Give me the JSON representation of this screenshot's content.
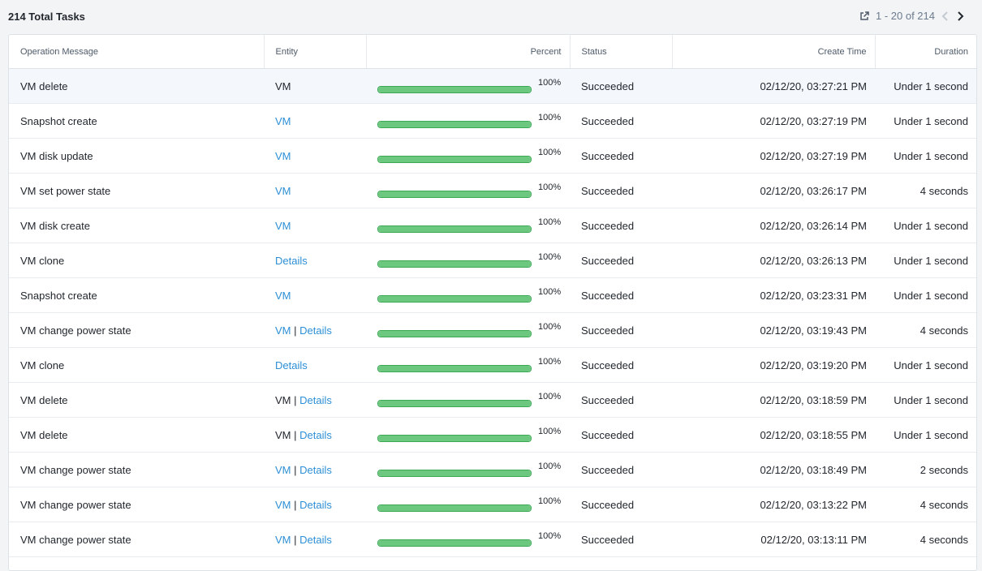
{
  "header": {
    "total_tasks": "214 Total Tasks",
    "pagination": "1 - 20 of 214",
    "icons": [
      "external-link-icon",
      "chevron-left-icon",
      "chevron-right-icon"
    ]
  },
  "columns": {
    "operation": "Operation Message",
    "entity": "Entity",
    "percent": "Percent",
    "status": "Status",
    "create_time": "Create Time",
    "duration": "Duration"
  },
  "colors": {
    "link": "#2d8fd5",
    "progress_fill": "#6cc87e",
    "progress_border": "#3da853"
  },
  "rows": [
    {
      "op": "VM delete",
      "entity": [
        {
          "text": "VM",
          "link": false
        }
      ],
      "progress": 1.0,
      "percent": "100%",
      "status": "Succeeded",
      "time": "02/12/20, 03:27:21 PM",
      "duration": "Under 1 second"
    },
    {
      "op": "Snapshot create",
      "entity": [
        {
          "text": "VM",
          "link": true
        }
      ],
      "progress": 1.0,
      "percent": "100%",
      "status": "Succeeded",
      "time": "02/12/20, 03:27:19 PM",
      "duration": "Under 1 second"
    },
    {
      "op": "VM disk update",
      "entity": [
        {
          "text": "VM",
          "link": true
        }
      ],
      "progress": 1.0,
      "percent": "100%",
      "status": "Succeeded",
      "time": "02/12/20, 03:27:19 PM",
      "duration": "Under 1 second"
    },
    {
      "op": "VM set power state",
      "entity": [
        {
          "text": "VM",
          "link": true
        }
      ],
      "progress": 1.0,
      "percent": "100%",
      "status": "Succeeded",
      "time": "02/12/20, 03:26:17 PM",
      "duration": "4 seconds"
    },
    {
      "op": "VM disk create",
      "entity": [
        {
          "text": "VM",
          "link": true
        }
      ],
      "progress": 1.0,
      "percent": "100%",
      "status": "Succeeded",
      "time": "02/12/20, 03:26:14 PM",
      "duration": "Under 1 second"
    },
    {
      "op": "VM clone",
      "entity": [
        {
          "text": "Details",
          "link": true
        }
      ],
      "progress": 1.0,
      "percent": "100%",
      "status": "Succeeded",
      "time": "02/12/20, 03:26:13 PM",
      "duration": "Under 1 second"
    },
    {
      "op": "Snapshot create",
      "entity": [
        {
          "text": "VM",
          "link": true
        }
      ],
      "progress": 1.0,
      "percent": "100%",
      "status": "Succeeded",
      "time": "02/12/20, 03:23:31 PM",
      "duration": "Under 1 second"
    },
    {
      "op": "VM change power state",
      "entity": [
        {
          "text": "VM",
          "link": true
        },
        {
          "text": "Details",
          "link": true
        }
      ],
      "progress": 1.0,
      "percent": "100%",
      "status": "Succeeded",
      "time": "02/12/20, 03:19:43 PM",
      "duration": "4 seconds"
    },
    {
      "op": "VM clone",
      "entity": [
        {
          "text": "Details",
          "link": true
        }
      ],
      "progress": 1.0,
      "percent": "100%",
      "status": "Succeeded",
      "time": "02/12/20, 03:19:20 PM",
      "duration": "Under 1 second"
    },
    {
      "op": "VM delete",
      "entity": [
        {
          "text": "VM",
          "link": false
        },
        {
          "text": "Details",
          "link": true
        }
      ],
      "progress": 1.0,
      "percent": "100%",
      "status": "Succeeded",
      "time": "02/12/20, 03:18:59 PM",
      "duration": "Under 1 second"
    },
    {
      "op": "VM delete",
      "entity": [
        {
          "text": "VM",
          "link": false
        },
        {
          "text": "Details",
          "link": true
        }
      ],
      "progress": 1.0,
      "percent": "100%",
      "status": "Succeeded",
      "time": "02/12/20, 03:18:55 PM",
      "duration": "Under 1 second"
    },
    {
      "op": "VM change power state",
      "entity": [
        {
          "text": "VM",
          "link": true
        },
        {
          "text": "Details",
          "link": true
        }
      ],
      "progress": 1.0,
      "percent": "100%",
      "status": "Succeeded",
      "time": "02/12/20, 03:18:49 PM",
      "duration": "2 seconds"
    },
    {
      "op": "VM change power state",
      "entity": [
        {
          "text": "VM",
          "link": true
        },
        {
          "text": "Details",
          "link": true
        }
      ],
      "progress": 1.0,
      "percent": "100%",
      "status": "Succeeded",
      "time": "02/12/20, 03:13:22 PM",
      "duration": "4 seconds"
    },
    {
      "op": "VM change power state",
      "entity": [
        {
          "text": "VM",
          "link": true
        },
        {
          "text": "Details",
          "link": true
        }
      ],
      "progress": 1.0,
      "percent": "100%",
      "status": "Succeeded",
      "time": "02/12/20, 03:13:11 PM",
      "duration": "4 seconds"
    }
  ]
}
